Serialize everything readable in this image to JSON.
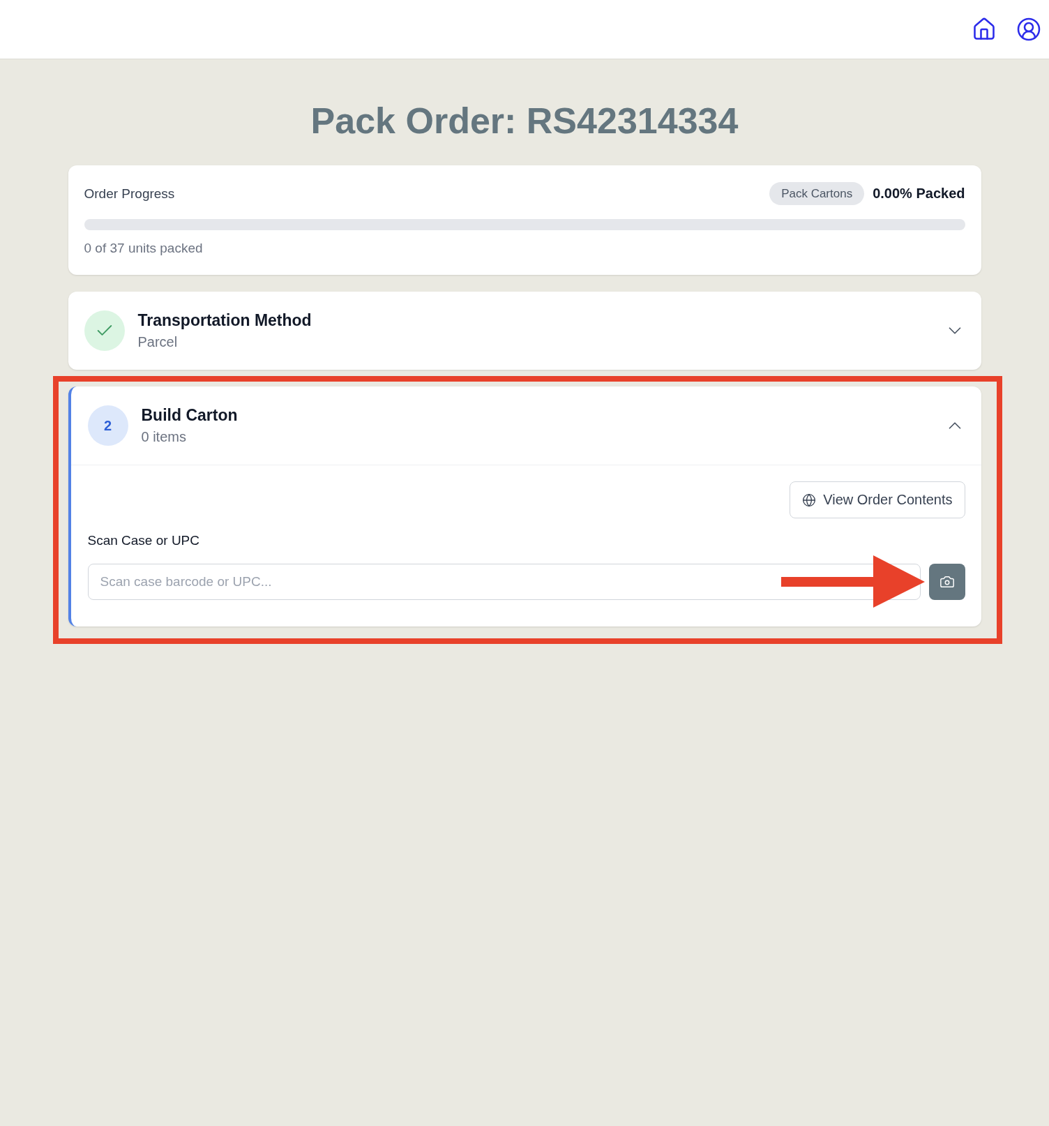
{
  "title": "Pack Order: RS42314334",
  "progress": {
    "label": "Order Progress",
    "badge": "Pack Cartons",
    "percent": "0.00% Packed",
    "level": 0,
    "summary": "0 of 37 units packed"
  },
  "steps": [
    {
      "kind": "complete",
      "title": "Transportation Method",
      "subtitle": "Parcel",
      "expanded": false,
      "highlighted": false
    },
    {
      "kind": "active",
      "number": "2",
      "title": "Build Carton",
      "subtitle": "0 items",
      "expanded": true,
      "highlighted": true,
      "action_button": "View Order Contents",
      "field_label": "Scan Case or UPC",
      "placeholder": "Scan case barcode or UPC..."
    }
  ]
}
